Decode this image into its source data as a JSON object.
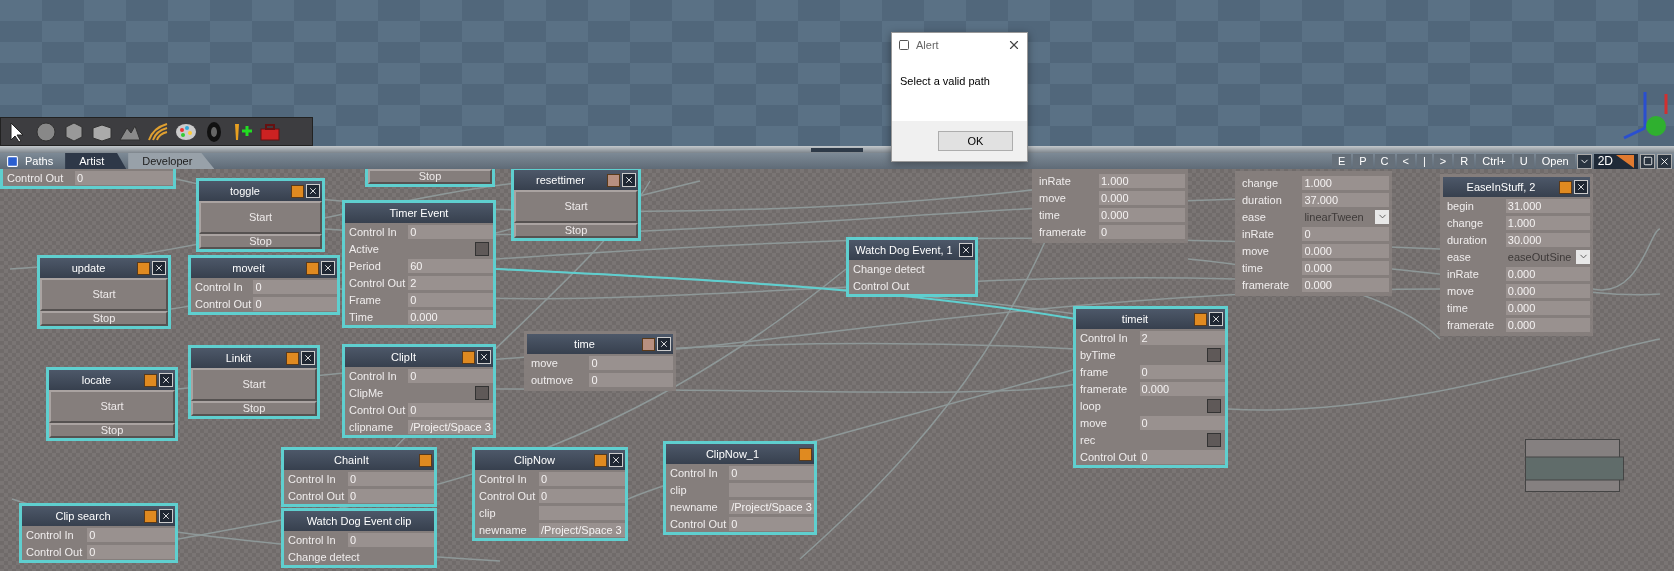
{
  "alert": {
    "title": "Alert",
    "message": "Select a valid path",
    "button": "OK"
  },
  "panel": {
    "title": "Paths",
    "tabs": [
      {
        "label": "Artist",
        "selected": true
      },
      {
        "label": "Developer",
        "selected": false
      }
    ],
    "toolbar": [
      "E",
      "P",
      "C",
      "<",
      "|",
      ">",
      "R",
      "Ctrl+",
      "U",
      "Open"
    ],
    "view_mode": "2D"
  },
  "nodes": [
    {
      "kind": "fields",
      "highlighted": true,
      "rows": [
        {
          "kind": "value",
          "label": "Control Out",
          "value": "0"
        }
      ]
    },
    {
      "kind": "buttons",
      "title": "toggle",
      "color": "#e08a20",
      "highlighted": true,
      "closable": true,
      "buttons": [
        {
          "kind": "large",
          "label": "Start"
        },
        {
          "kind": "small",
          "label": "Stop"
        }
      ]
    },
    {
      "kind": "buttons",
      "highlighted": true,
      "buttons": [
        {
          "kind": "small",
          "label": "Stop"
        }
      ]
    },
    {
      "kind": "buttons",
      "title": "resettimer",
      "color": "#b89080",
      "highlighted": true,
      "closable": true,
      "buttons": [
        {
          "kind": "large",
          "label": "Start"
        },
        {
          "kind": "small",
          "label": "Stop"
        }
      ]
    },
    {
      "kind": "fields",
      "highlighted": false,
      "rows": [
        {
          "kind": "value",
          "label": "inRate",
          "value": "1.000"
        },
        {
          "kind": "value",
          "label": "move",
          "value": "0.000"
        },
        {
          "kind": "value",
          "label": "time",
          "value": "0.000"
        },
        {
          "kind": "value",
          "label": "framerate",
          "value": "0"
        }
      ]
    },
    {
      "kind": "buttons",
      "title": "update",
      "color": "#e08a20",
      "highlighted": true,
      "closable": true,
      "buttons": [
        {
          "kind": "large",
          "label": "Start"
        },
        {
          "kind": "small",
          "label": "Stop"
        }
      ]
    },
    {
      "kind": "fields",
      "title": "moveit",
      "color": "#e08a20",
      "highlighted": true,
      "closable": true,
      "rows": [
        {
          "kind": "value",
          "label": "Control In",
          "value": "0"
        },
        {
          "kind": "value",
          "label": "Control Out",
          "value": "0"
        }
      ]
    },
    {
      "kind": "fields",
      "title": "Timer Event",
      "highlighted": true,
      "closable": false,
      "rows": [
        {
          "kind": "value",
          "label": "Control In",
          "value": "0"
        },
        {
          "kind": "check",
          "label": "Active",
          "checked": false
        },
        {
          "kind": "value",
          "label": "Period",
          "value": "60"
        },
        {
          "kind": "value",
          "label": "Control Out",
          "value": "2"
        },
        {
          "kind": "value",
          "label": "Frame",
          "value": "0"
        },
        {
          "kind": "value",
          "label": "Time",
          "value": "0.000"
        }
      ]
    },
    {
      "kind": "fields",
      "title": "Watch Dog Event, 1",
      "highlighted": true,
      "closable": true,
      "rows": [
        {
          "kind": "port",
          "label": "Change detect"
        },
        {
          "kind": "port",
          "label": "Control Out"
        }
      ]
    },
    {
      "kind": "fields",
      "highlighted": false,
      "rows": [
        {
          "kind": "value",
          "label": "change",
          "value": "1.000"
        },
        {
          "kind": "value",
          "label": "duration",
          "value": "37.000"
        },
        {
          "kind": "dropdown",
          "label": "ease",
          "value": "linearTween"
        },
        {
          "kind": "value",
          "label": "inRate",
          "value": "0"
        },
        {
          "kind": "value",
          "label": "move",
          "value": "0.000"
        },
        {
          "kind": "value",
          "label": "time",
          "value": "0.000"
        },
        {
          "kind": "value",
          "label": "framerate",
          "value": "0.000"
        }
      ]
    },
    {
      "kind": "fields",
      "title": "EaseInStuff, 2",
      "color": "#e08a20",
      "highlighted": false,
      "closable": true,
      "rows": [
        {
          "kind": "value",
          "label": "begin",
          "value": "31.000"
        },
        {
          "kind": "value",
          "label": "change",
          "value": "1.000"
        },
        {
          "kind": "value",
          "label": "duration",
          "value": "30.000"
        },
        {
          "kind": "dropdown",
          "label": "ease",
          "value": "easeOutSine"
        },
        {
          "kind": "value",
          "label": "inRate",
          "value": "0.000"
        },
        {
          "kind": "value",
          "label": "move",
          "value": "0.000"
        },
        {
          "kind": "value",
          "label": "time",
          "value": "0.000"
        },
        {
          "kind": "value",
          "label": "framerate",
          "value": "0.000"
        }
      ]
    },
    {
      "kind": "buttons",
      "title": "locate",
      "color": "#e08a20",
      "highlighted": true,
      "closable": true,
      "buttons": [
        {
          "kind": "large",
          "label": "Start"
        },
        {
          "kind": "small",
          "label": "Stop"
        }
      ]
    },
    {
      "kind": "buttons",
      "title": "Linkit",
      "color": "#e08a20",
      "highlighted": true,
      "closable": true,
      "buttons": [
        {
          "kind": "large",
          "label": "Start"
        },
        {
          "kind": "small",
          "label": "Stop"
        }
      ]
    },
    {
      "kind": "fields",
      "title": "ClipIt",
      "color": "#e08a20",
      "highlighted": true,
      "closable": true,
      "rows": [
        {
          "kind": "value",
          "label": "Control In",
          "value": "0"
        },
        {
          "kind": "check",
          "label": "ClipMe",
          "checked": false
        },
        {
          "kind": "value",
          "label": "Control Out",
          "value": "0"
        },
        {
          "kind": "value",
          "label": "clipname",
          "value": "/Project/Space 3"
        }
      ]
    },
    {
      "kind": "fields",
      "title": "time",
      "color": "#b89080",
      "highlighted": false,
      "closable": true,
      "rows": [
        {
          "kind": "value",
          "label": "move",
          "value": "0"
        },
        {
          "kind": "value",
          "label": "outmove",
          "value": "0"
        }
      ]
    },
    {
      "kind": "fields",
      "title": "timeit",
      "color": "#e08a20",
      "highlighted": true,
      "closable": true,
      "rows": [
        {
          "kind": "value",
          "label": "Control In",
          "value": "2"
        },
        {
          "kind": "check",
          "label": "byTime",
          "checked": false
        },
        {
          "kind": "value",
          "label": "frame",
          "value": "0"
        },
        {
          "kind": "value",
          "label": "framerate",
          "value": "0.000"
        },
        {
          "kind": "check",
          "label": "loop",
          "checked": false
        },
        {
          "kind": "value",
          "label": "move",
          "value": "0"
        },
        {
          "kind": "check",
          "label": "rec",
          "checked": false
        },
        {
          "kind": "value",
          "label": "Control Out",
          "value": "0"
        }
      ]
    },
    {
      "kind": "fields",
      "title": "Clip search",
      "color": "#e08a20",
      "highlighted": true,
      "closable": true,
      "rows": [
        {
          "kind": "value",
          "label": "Control In",
          "value": "0"
        },
        {
          "kind": "value",
          "label": "Control Out",
          "value": "0"
        }
      ]
    },
    {
      "kind": "fields",
      "title": "ChainIt",
      "color": "#e08a20",
      "highlighted": true,
      "closable": false,
      "rows": [
        {
          "kind": "value",
          "label": "Control In",
          "value": "0"
        },
        {
          "kind": "value",
          "label": "Control Out",
          "value": "0"
        }
      ]
    },
    {
      "kind": "fields",
      "title": "Watch Dog Event clip",
      "highlighted": true,
      "closable": false,
      "rows": [
        {
          "kind": "value",
          "label": "Control In",
          "value": "0"
        },
        {
          "kind": "port",
          "label": "Change detect"
        }
      ]
    },
    {
      "kind": "fields",
      "title": "ClipNow",
      "color": "#e08a20",
      "highlighted": true,
      "closable": true,
      "rows": [
        {
          "kind": "value",
          "label": "Control In",
          "value": "0"
        },
        {
          "kind": "value",
          "label": "Control Out",
          "value": "0"
        },
        {
          "kind": "value",
          "label": "clip"
        },
        {
          "kind": "value",
          "label": "newname",
          "value": "/Project/Space 3"
        }
      ]
    },
    {
      "kind": "fields",
      "title": "ClipNow_1",
      "color": "#e08a20",
      "highlighted": true,
      "closable": false,
      "rows": [
        {
          "kind": "value",
          "label": "Control In",
          "value": "0"
        },
        {
          "kind": "value",
          "label": "clip"
        },
        {
          "kind": "value",
          "label": "newname",
          "value": "/Project/Space 3"
        },
        {
          "kind": "value",
          "label": "Control Out",
          "value": "0"
        }
      ]
    }
  ]
}
